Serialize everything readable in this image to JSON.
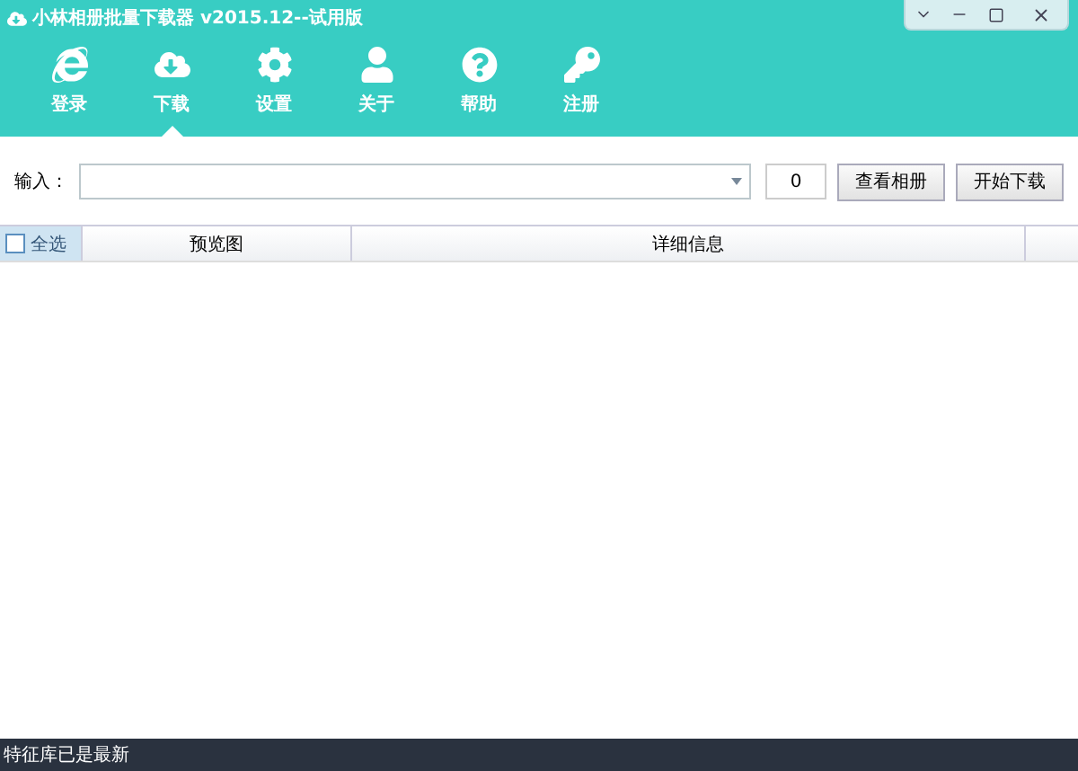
{
  "window": {
    "title": "小林相册批量下载器 v2015.12--试用版"
  },
  "toolbar": [
    {
      "label": "登录",
      "selected": false
    },
    {
      "label": "下载",
      "selected": true
    },
    {
      "label": "设置",
      "selected": false
    },
    {
      "label": "关于",
      "selected": false
    },
    {
      "label": "帮助",
      "selected": false
    },
    {
      "label": "注册",
      "selected": false
    }
  ],
  "input_row": {
    "label": "输入：",
    "count": "0",
    "buttons": [
      "查看相册",
      "开始下载"
    ]
  },
  "table": {
    "select_all": {
      "label": "全选",
      "checked": false
    },
    "columns": [
      "预览图",
      "详细信息"
    ]
  },
  "status_bar": "特征库已是最新"
}
